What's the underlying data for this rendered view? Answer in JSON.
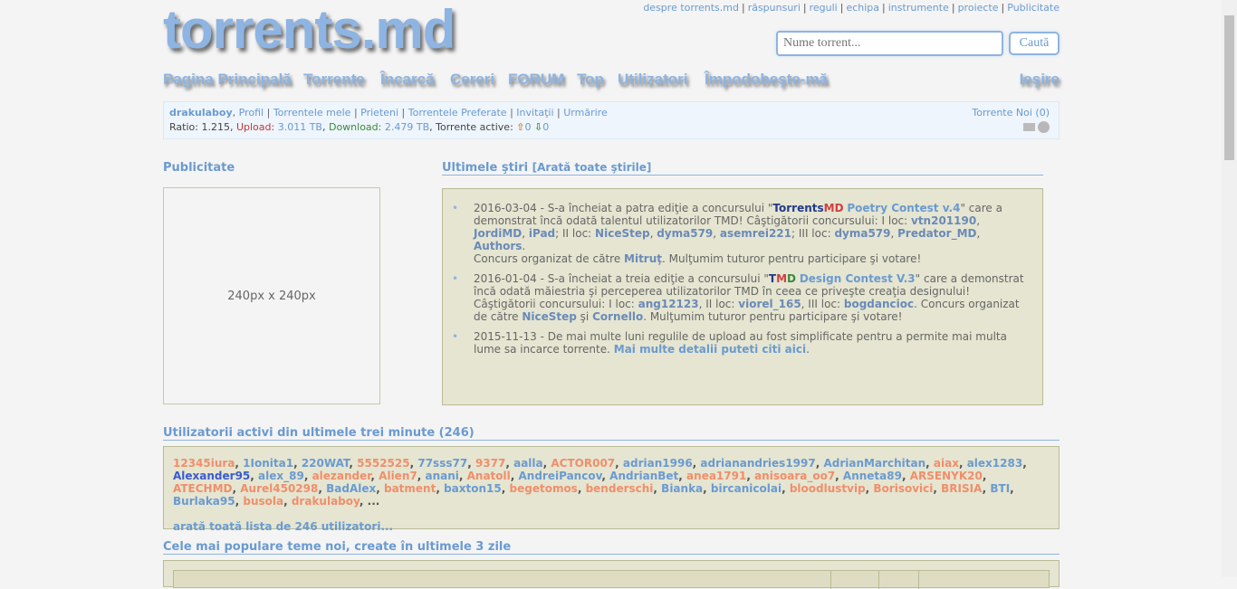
{
  "header": {
    "logo": "torrents.md",
    "top_links": [
      "despre torrents.md",
      "răspunsuri",
      "reguli",
      "echipa",
      "instrumente",
      "proiecte",
      "Publicitate"
    ],
    "search_placeholder": "Nume torrent...",
    "search_button": "Caută"
  },
  "nav": {
    "items": [
      "Pagina Principală",
      "Torrente",
      "Încarcă",
      "Cereri",
      "FORUM",
      "Top",
      "Utilizatori",
      "Împodobeşte-mă"
    ],
    "logout": "Ieşire"
  },
  "userbar": {
    "username": "drakulaboy",
    "links": [
      "Profil",
      "Torrentele mele",
      "Prieteni",
      "Torrentele Preferate",
      "Invitaţii",
      "Urmărire"
    ],
    "ratio_label": "Ratio:",
    "ratio": "1.215",
    "upload_label": "Upload:",
    "upload": "3.011 TB",
    "download_label": "Download:",
    "download": "2.479 TB",
    "active_label": "Torrente active:",
    "active_up": "0",
    "active_down": "0",
    "new_torrents": "Torrente Noi",
    "new_torrents_count": "(0)"
  },
  "ads": {
    "title": "Publicitate",
    "placeholder": "240px x 240px"
  },
  "news": {
    "title": "Ultimele ştiri",
    "show_all": "Arată toate ştirile",
    "items": [
      {
        "date": "2016-03-04",
        "text": " - S-a încheiat a patra ediţie a concursului \"",
        "brand1": "Torrents",
        "brand2": "MD",
        "contest": "Poetry Contest v.4",
        "text2": "\" care a demonstrat încă odată talentul utilizatorilor TMD! Câştigătorii concursului: I loc: ",
        "winners1": [
          "vtn201190",
          "JordiMD",
          "iPad"
        ],
        "l2": "; II loc: ",
        "winners2": [
          "NiceStep",
          "dyma579",
          "asemrei221"
        ],
        "l3": "; III loc: ",
        "winners3": [
          "dyma579",
          "Predator_MD",
          "Authors"
        ],
        "org": "Concurs organizat de către ",
        "organizer": "Mitruţ",
        "thanks": ". Mulţumim tuturor pentru participare şi votare!"
      },
      {
        "date": "2016-01-04",
        "text": " - S-a încheiat a treia ediţie a concursului \"",
        "brand": "TMD",
        "contest": "Design Contest V.3",
        "text2": "\" care a demonstrat încă odată măiestria şi perceperea utilizatorilor TMD în ceea ce priveşte creaţia designului! Câştigătorii concursului: I loc: ",
        "w1": "ang12123",
        "l2": ", II loc: ",
        "w2": "viorel_165",
        "l3": ", III loc: ",
        "w3": "bogdancioc",
        "org": ". Concurs organizat de către ",
        "org1": "NiceStep",
        "and": " şi ",
        "org2": "Cornello",
        "thanks": ". Mulţumim tuturor pentru participare şi votare!"
      },
      {
        "date": "2015-11-13",
        "text": " - De mai multe luni regulile de upload au fost simplificate pentru a permite mai multa lume sa incarce torrente. ",
        "link": "Mai multe detalii puteti citi aici",
        "end": "."
      }
    ]
  },
  "active_users": {
    "title": "Utilizatorii activi din ultimele trei minute (246)",
    "users": [
      {
        "n": "12345iura",
        "c": "o"
      },
      {
        "n": "1Ionita1",
        "c": ""
      },
      {
        "n": "220WAT",
        "c": ""
      },
      {
        "n": "5552525",
        "c": "o"
      },
      {
        "n": "77sss77",
        "c": ""
      },
      {
        "n": "9377",
        "c": "o"
      },
      {
        "n": "aalla",
        "c": ""
      },
      {
        "n": "ACTOR007",
        "c": "o"
      },
      {
        "n": "adrian1996",
        "c": ""
      },
      {
        "n": "adrianandries1997",
        "c": ""
      },
      {
        "n": "AdrianMarchitan",
        "c": ""
      },
      {
        "n": "aiax",
        "c": "o"
      },
      {
        "n": "alex1283",
        "c": ""
      },
      {
        "n": "Alexander95",
        "c": "b"
      },
      {
        "n": "alex_89",
        "c": ""
      },
      {
        "n": "alezander",
        "c": "o"
      },
      {
        "n": "Alien7",
        "c": "o"
      },
      {
        "n": "anani",
        "c": ""
      },
      {
        "n": "Anatoll",
        "c": "o"
      },
      {
        "n": "AndreiPancov",
        "c": ""
      },
      {
        "n": "AndrianBet",
        "c": ""
      },
      {
        "n": "anea1791",
        "c": "o"
      },
      {
        "n": "anisoara_oo7",
        "c": "o"
      },
      {
        "n": "Anneta89",
        "c": ""
      },
      {
        "n": "ARSENYK20",
        "c": "o"
      },
      {
        "n": "ATECHMD",
        "c": "o"
      },
      {
        "n": "Aurel450298",
        "c": "o"
      },
      {
        "n": "BadAlex",
        "c": ""
      },
      {
        "n": "batment",
        "c": "o"
      },
      {
        "n": "baxton15",
        "c": ""
      },
      {
        "n": "begetomos",
        "c": "o"
      },
      {
        "n": "benderschi",
        "c": "o"
      },
      {
        "n": "Bianka",
        "c": ""
      },
      {
        "n": "bircanicolai",
        "c": ""
      },
      {
        "n": "bloodlustvip",
        "c": "o"
      },
      {
        "n": "Borisovici",
        "c": "o"
      },
      {
        "n": "BRISIA",
        "c": "o"
      },
      {
        "n": "BTI",
        "c": ""
      },
      {
        "n": "Burlaka95",
        "c": ""
      },
      {
        "n": "busola",
        "c": "o"
      },
      {
        "n": "drakulaboy",
        "c": "o"
      }
    ],
    "ellipsis": "...",
    "show_all": "arată toată lista de 246 utilizatori..."
  },
  "popular": {
    "title": "Cele mai populare teme noi, create în ultimele 3 zile"
  },
  "colors": {
    "accent": "#8db4e2",
    "box_bg": "#e5e5d1",
    "box_border": "#b9ba96",
    "orange_user": "#f08e6a"
  }
}
